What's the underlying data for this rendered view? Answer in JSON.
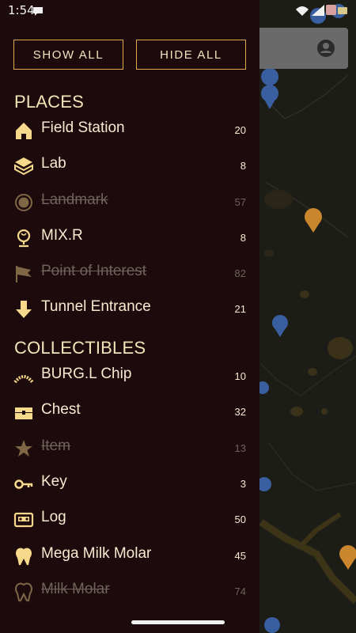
{
  "status_bar": {
    "time": "1:54"
  },
  "buttons": {
    "show_all": "SHOW ALL",
    "hide_all": "HIDE ALL"
  },
  "sections": {
    "places": {
      "title": "PLACES",
      "items": [
        {
          "label": "Field Station",
          "count": "20",
          "enabled": true,
          "icon": "field-station-icon"
        },
        {
          "label": "Lab",
          "count": "8",
          "enabled": true,
          "icon": "lab-icon"
        },
        {
          "label": "Landmark",
          "count": "57",
          "enabled": false,
          "icon": "landmark-icon"
        },
        {
          "label": "MIX.R",
          "count": "8",
          "enabled": true,
          "icon": "mixr-icon"
        },
        {
          "label": "Point of Interest",
          "count": "82",
          "enabled": false,
          "icon": "flag-icon"
        },
        {
          "label": "Tunnel Entrance",
          "count": "21",
          "enabled": true,
          "icon": "down-arrow-icon"
        }
      ]
    },
    "collectibles": {
      "title": "COLLECTIBLES",
      "items": [
        {
          "label": "BURG.L Chip",
          "count": "10",
          "enabled": true,
          "icon": "chip-icon"
        },
        {
          "label": "Chest",
          "count": "32",
          "enabled": true,
          "icon": "chest-icon"
        },
        {
          "label": "Item",
          "count": "13",
          "enabled": false,
          "icon": "star-icon"
        },
        {
          "label": "Key",
          "count": "3",
          "enabled": true,
          "icon": "key-icon"
        },
        {
          "label": "Log",
          "count": "50",
          "enabled": true,
          "icon": "cassette-icon"
        },
        {
          "label": "Mega Milk Molar",
          "count": "45",
          "enabled": true,
          "icon": "molar-filled-icon"
        },
        {
          "label": "Milk Molar",
          "count": "74",
          "enabled": false,
          "icon": "molar-outline-icon"
        }
      ]
    }
  },
  "colors": {
    "drawer_bg": "#1c0a0d",
    "accent": "#e0a94d",
    "text": "#f6ead0",
    "disabled_text": "#6e625a"
  }
}
